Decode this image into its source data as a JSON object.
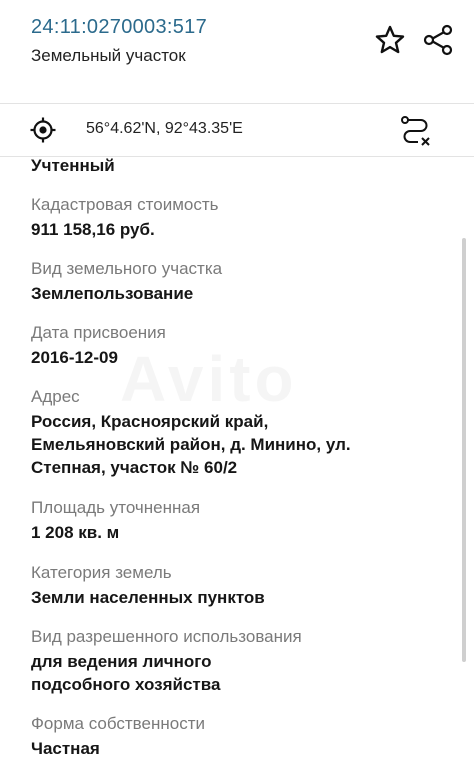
{
  "header": {
    "cadastral_number": "24:11:0270003:517",
    "object_type": "Земельный участок"
  },
  "coords_bar": {
    "coordinates": "56°4.62'N, 92°43.35'E"
  },
  "fields": {
    "status_value": "Учтенный",
    "cadastral_value": {
      "label": "Кадастровая стоимость",
      "value": "911 158,16 руб."
    },
    "plot_type": {
      "label": "Вид земельного участка",
      "value": "Землепользование"
    },
    "assign_date": {
      "label": "Дата присвоения",
      "value": "2016-12-09"
    },
    "address": {
      "label": "Адрес",
      "lines": [
        "Россия, Красноярский край,",
        "Емельяновский район, д. Минино, ул.",
        "Степная, участок № 60/2"
      ]
    },
    "area": {
      "label": "Площадь уточненная",
      "value": "1 208 кв. м"
    },
    "land_category": {
      "label": "Категория земель",
      "value": "Земли населенных пунктов"
    },
    "permitted_use": {
      "label": "Вид разрешенного использования",
      "lines": [
        "для ведения личного",
        "подсобного хозяйства"
      ]
    },
    "ownership": {
      "label": "Форма собственности",
      "value": "Частная"
    }
  },
  "icons": {
    "favorite": "star-icon",
    "share": "share-icon",
    "locate": "target-icon",
    "route": "route-icon"
  },
  "colors": {
    "cadastral_number": "#2b6a8c",
    "label": "#7a7a7a",
    "value": "#161616"
  }
}
